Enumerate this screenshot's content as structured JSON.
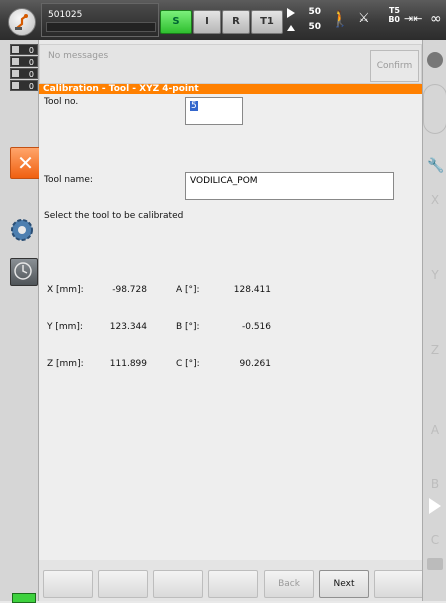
{
  "status_bar": {
    "robot_name": "501025",
    "mode_s": "S",
    "mode_i": "I",
    "mode_r": "R",
    "mode_t1": "T1",
    "override_prog": "50",
    "override_jog": "50",
    "tool_number": "T5",
    "base_number": "B0",
    "end_symbol": "∞"
  },
  "left_bar": {
    "msg_counts": [
      "0",
      "0",
      "0",
      "0"
    ]
  },
  "messages": {
    "text": "No messages",
    "confirm_all": "Confirm all"
  },
  "panel": {
    "title": "Calibration - Tool - XYZ 4-point",
    "tool_no_label": "Tool no.",
    "tool_no_value": "5",
    "tool_name_label": "Tool name:",
    "tool_name_value": "VODILICA_POM",
    "instruction": "Select the tool to be calibrated",
    "coords": [
      {
        "label": "X [mm]:",
        "value": "-98.728",
        "angle_label": "A [°]:",
        "angle_value": "128.411"
      },
      {
        "label": "Y [mm]:",
        "value": "123.344",
        "angle_label": "B [°]:",
        "angle_value": "-0.516"
      },
      {
        "label": "Z [mm]:",
        "value": "111.899",
        "angle_label": "C [°]:",
        "angle_value": "90.261"
      }
    ]
  },
  "softkeys": {
    "back": "Back",
    "next": "Next"
  },
  "right_bar": {
    "axes": [
      "X",
      "Y",
      "Z",
      "A",
      "B",
      "C"
    ]
  },
  "colors": {
    "accent_orange": "#ff8000",
    "status_green": "#3ed13e"
  }
}
